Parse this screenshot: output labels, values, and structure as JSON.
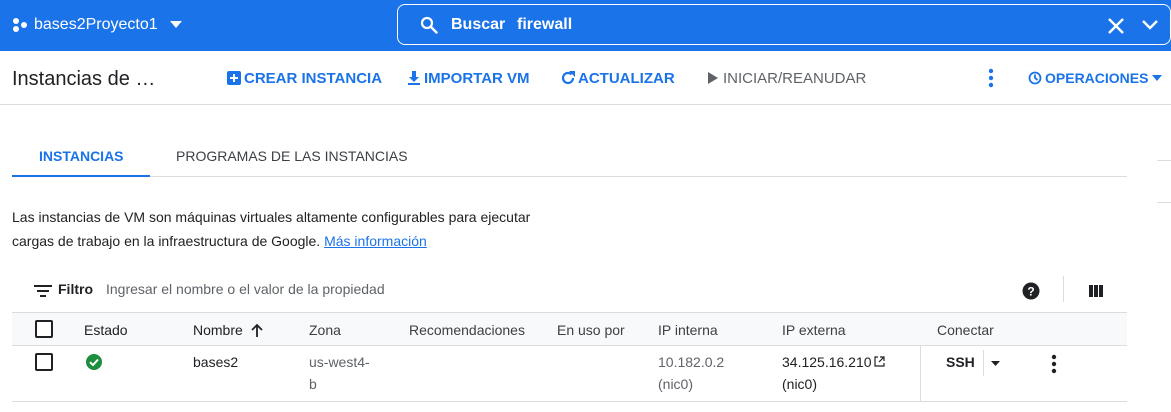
{
  "topbar": {
    "project_name": "bases2Proyecto1",
    "search_label": "Buscar",
    "search_value": "firewall"
  },
  "toolbar": {
    "page_title": "Instancias de …",
    "create_instance": "CREAR INSTANCIA",
    "import_vm": "IMPORTAR VM",
    "refresh": "ACTUALIZAR",
    "start_resume": "INICIAR/REANUDAR",
    "operations": "OPERACIONES"
  },
  "tabs": [
    {
      "label": "INSTANCIAS",
      "active": true
    },
    {
      "label": "PROGRAMAS DE LAS INSTANCIAS",
      "active": false
    }
  ],
  "description": {
    "line1": "Las instancias de VM son máquinas virtuales altamente configurables para ejecutar",
    "line2": "cargas de trabajo en la infraestructura de Google.",
    "link": "Más información"
  },
  "filter": {
    "label": "Filtro",
    "placeholder": "Ingresar el nombre o el valor de la propiedad"
  },
  "table": {
    "columns": {
      "status": "Estado",
      "name": "Nombre",
      "zone": "Zona",
      "recommendations": "Recomendaciones",
      "in_use_by": "En uso por",
      "internal_ip": "IP interna",
      "external_ip": "IP externa",
      "connect": "Conectar"
    },
    "rows": [
      {
        "status": "running",
        "name": "bases2",
        "zone_line1": "us-west4-",
        "zone_line2": "b",
        "internal_ip": "10.182.0.2",
        "internal_nic": "(nic0)",
        "external_ip": "34.125.16.210",
        "external_nic": "(nic0)",
        "connect": "SSH"
      }
    ]
  },
  "colors": {
    "brand_blue": "#1a73e8",
    "status_green": "#1e8e3e",
    "border": "#dadce0"
  }
}
